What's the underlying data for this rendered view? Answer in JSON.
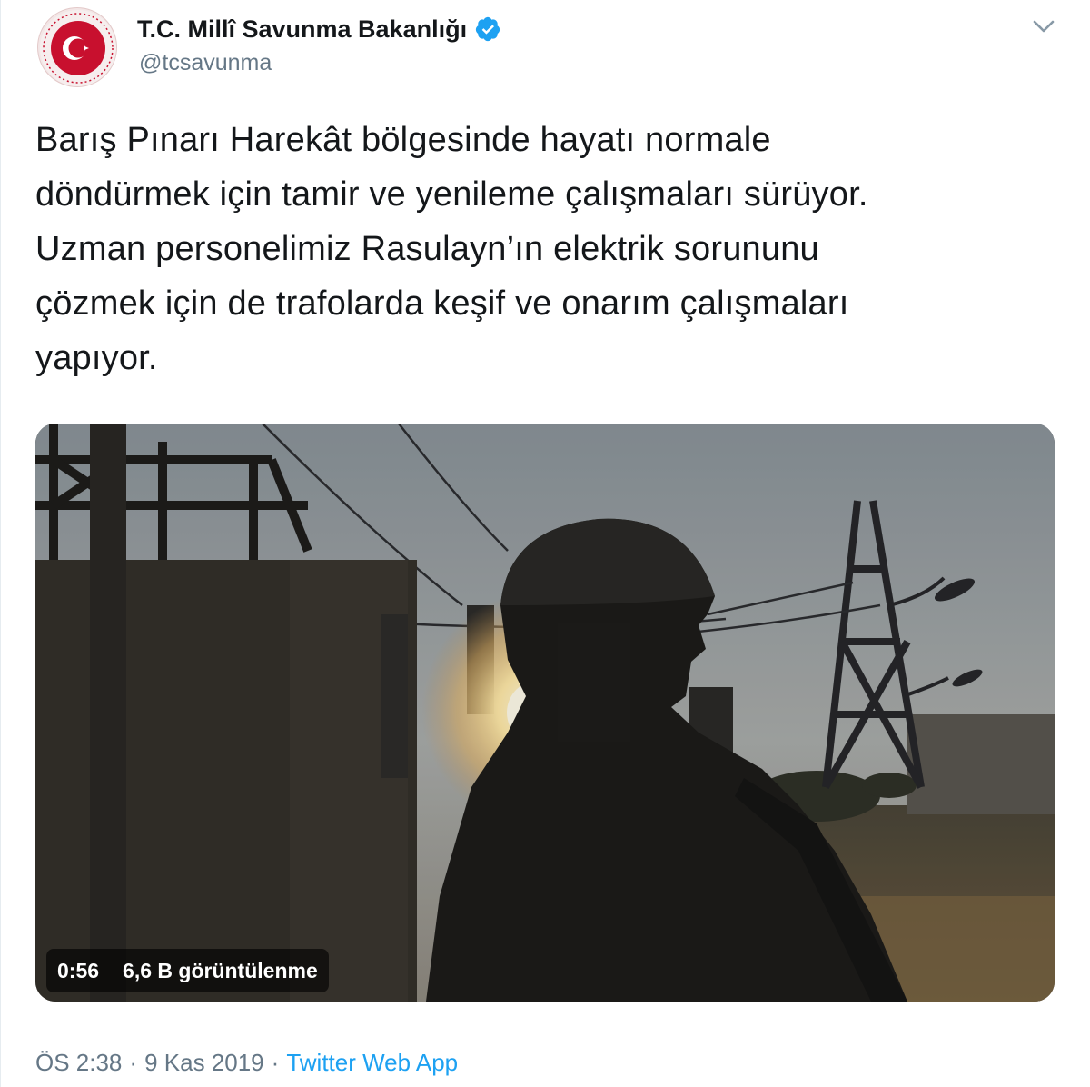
{
  "tweet": {
    "display_name": "T.C. Millî Savunma Bakanlığı",
    "handle": "@tcsavunma",
    "verified": true,
    "text_lines": [
      "Barış Pınarı Harekât bölgesinde hayatı normale",
      "döndürmek için tamir ve yenileme çalışmaları sürüyor.",
      "Uzman personelimiz Rasulayn’ın elektrik sorununu",
      "çözmek için de trafolarda keşif ve onarım çalışmaları",
      "yapıyor."
    ],
    "video": {
      "duration": "0:56",
      "views": "6,6 B görüntülenme"
    },
    "meta": {
      "time": "ÖS 2:38",
      "separator1": "·",
      "date": "9 Kas 2019",
      "separator2": "·",
      "source": "Twitter Web App"
    }
  },
  "icons": {
    "avatar": "ministry-emblem-icon",
    "verified": "verified-badge-icon",
    "caret": "chevron-down-icon"
  },
  "colors": {
    "name": "#14171a",
    "secondary": "#657786",
    "link": "#1da1f2",
    "verified": "#1da1f2",
    "emblem_red": "#c8102e"
  }
}
